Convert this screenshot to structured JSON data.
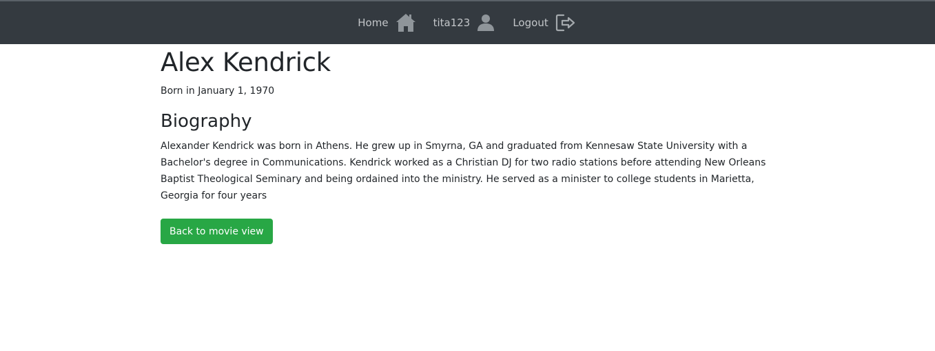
{
  "nav": {
    "home_label": "Home",
    "home_icon": "home-icon",
    "user_label": "tita123",
    "user_icon": "user-icon",
    "logout_label": "Logout",
    "logout_icon": "logout-icon",
    "bg_color": "#343a40",
    "text_color": "#c3c6c9"
  },
  "director": {
    "name": "Alex Kendrick",
    "born": "Born in January 1, 1970",
    "bio_heading": "Biography",
    "bio_text": "Alexander Kendrick was born in Athens. He grew up in Smyrna, GA and graduated from Kennesaw State University with a Bachelor's degree in Communications. Kendrick worked as a Christian DJ for two radio stations before attending New Orleans Baptist Theological Seminary and being ordained into the ministry. He served as a minister to college students in Marietta, Georgia for four years"
  },
  "actions": {
    "back_label": "Back to movie view",
    "back_color": "#28a745"
  }
}
